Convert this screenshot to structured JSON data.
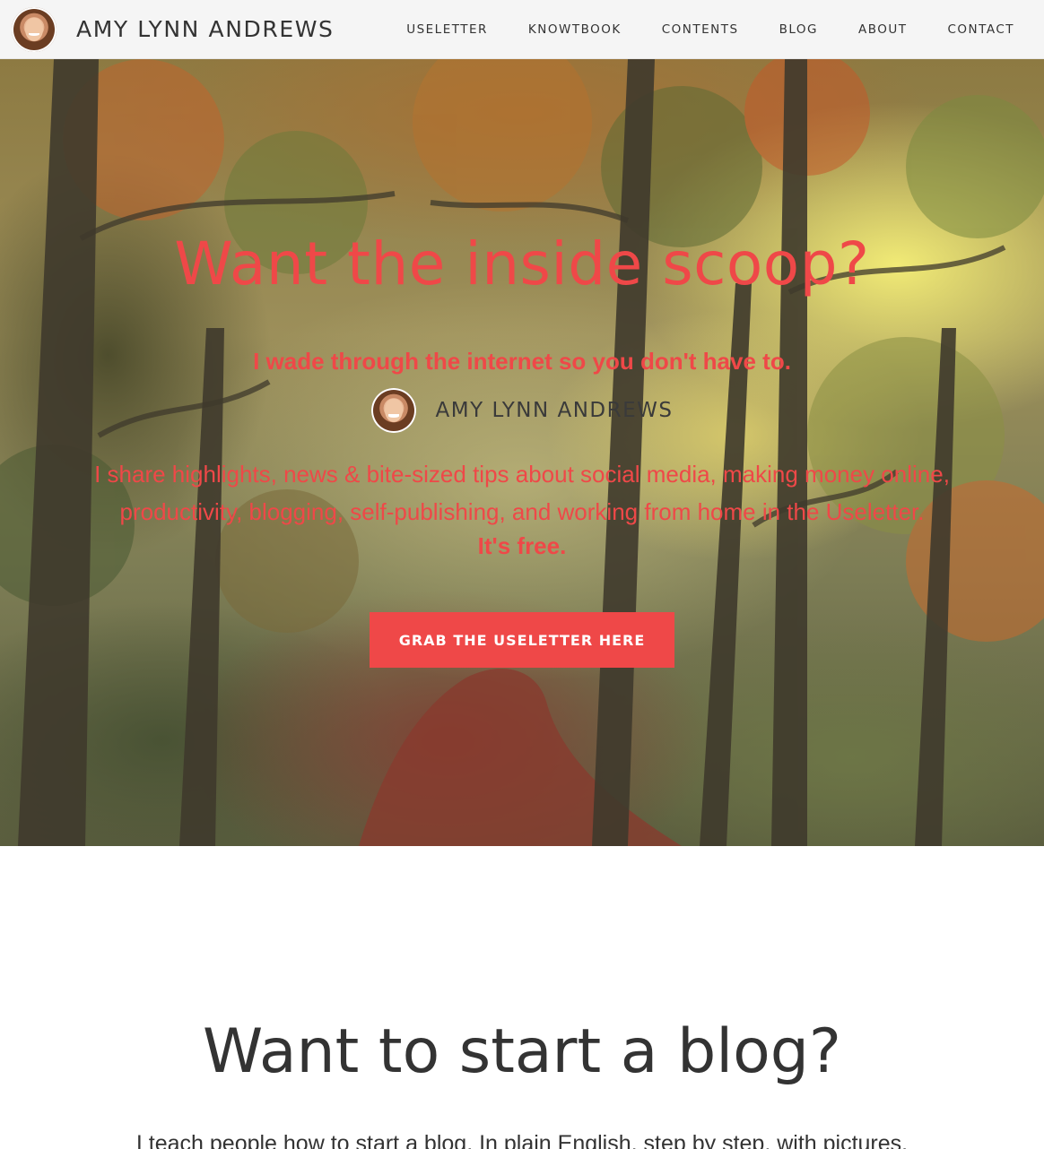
{
  "header": {
    "site_name": "AMY LYNN ANDREWS",
    "nav": [
      {
        "label": "USELETTER"
      },
      {
        "label": "KNOWTBOOK"
      },
      {
        "label": "CONTENTS"
      },
      {
        "label": "BLOG"
      },
      {
        "label": "ABOUT"
      },
      {
        "label": "CONTACT"
      }
    ]
  },
  "hero": {
    "title": "Want the inside scoop?",
    "tagline": "I wade through the internet so you don't have to.",
    "author_name": "AMY LYNN ANDREWS",
    "description": "I share highlights, news & bite-sized tips about social media, making money online, productivity, blogging, self-publishing, and working from home in the Useletter.",
    "free_note": "It's free.",
    "cta_label": "GRAB THE USELETTER HERE"
  },
  "blog_section": {
    "title": "Want to start a blog?",
    "intro": "I teach people how to start a blog. In plain English, step by step, with pictures."
  },
  "colors": {
    "accent": "#ef4848",
    "header_bg": "#f5f5f5",
    "text": "#333333"
  }
}
